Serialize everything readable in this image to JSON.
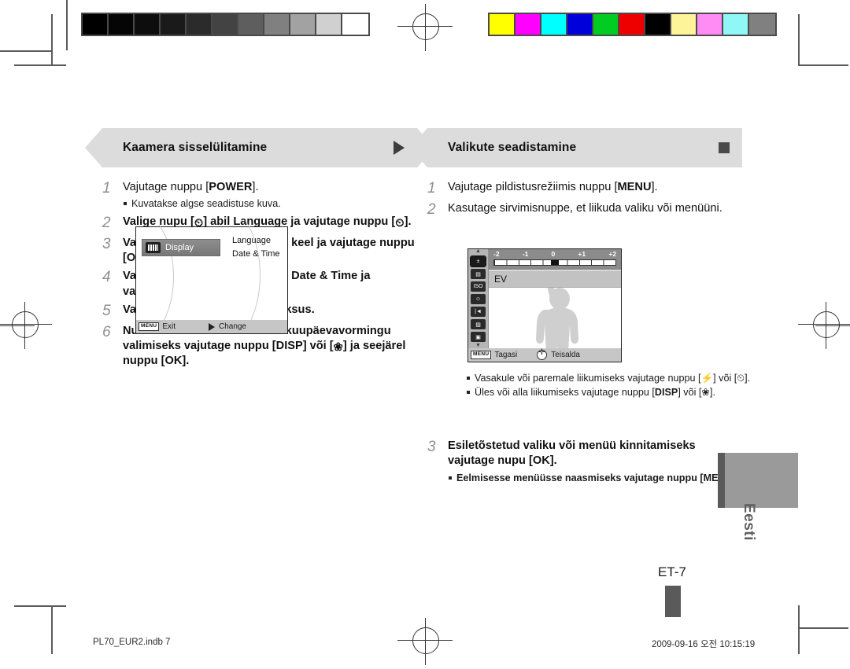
{
  "document": {
    "page_number": "ET-7",
    "language_tab": "Eesti",
    "footer_left": "PL70_EUR2.indb   7",
    "footer_right": "2009-09-16   오전 10:15:19"
  },
  "calibration": {
    "grayscale_label": "grayscale-step-wedge",
    "grayscale_patches": [
      "#000000",
      "#050505",
      "#0d0d0d",
      "#1a1a1a",
      "#2b2b2b",
      "#434343",
      "#5e5e5e",
      "#808080",
      "#a2a2a2",
      "#d0d0d0",
      "#ffffff"
    ],
    "color_label": "color-control-bar",
    "color_patches": [
      "#ffff00",
      "#ff00ff",
      "#00ffff",
      "#0000dd",
      "#00cc22",
      "#ee0000",
      "#000000",
      "#fdf398",
      "#ff8cf5",
      "#90f7f7",
      "#808080"
    ]
  },
  "left_column": {
    "banner": {
      "title": "Kaamera sisselülitamine",
      "marker": "triangle-right"
    },
    "steps": [
      {
        "num": "1",
        "text_html": "Vajutage nuppu [<b>POWER</b>].",
        "bold": false,
        "bullets": [
          "Kuvatakse algse seadistuse kuva."
        ]
      },
      {
        "num": "2",
        "text_html": "Valige nupu [<span class=\"gicon\">&#x23F2;</span>] abil <b>Language</b> ja vajutage nuppu [<span class=\"gicon\">&#x23F2;</span>].",
        "bold": true,
        "bullets": []
      },
      {
        "num": "3",
        "text_html": "Valige nupu [<b>DISP</b>] või [<span class=\"gicon\">&#x2740;</span>] abil keel ja vajutage nuppu [<b>OK</b>].",
        "bold": true,
        "bullets": []
      },
      {
        "num": "4",
        "text_html": "Valige nupu [<b>DISP</b>] või [<span class=\"gicon\">&#x2740;</span>] abil <b>Date &amp; Time</b> ja vajutage nuppu [<span class=\"gicon\">&#x23F2;</span>].",
        "bold": true,
        "bullets": []
      },
      {
        "num": "5",
        "text_html": "Valige nupu [<b>&#x26A1;</b>] või [<span class=\"gicon\">&#x23F2;</span>] abil üksus.",
        "bold": true,
        "bullets": []
      },
      {
        "num": "6",
        "text_html": "Numbri muutmiseks või teise kuupäevavormingu valimiseks vajutage nuppu [<b>DISP</b>] või [<span class=\"gicon\">&#x2740;</span>] ja seejärel nuppu [<b>OK</b>].",
        "bold": true,
        "bullets": []
      }
    ],
    "lcd": {
      "selected_item": "Display",
      "menu_items": [
        "Language",
        "Date & Time"
      ],
      "bottom_menu_chip": "MENU",
      "bottom_left_label": "Exit",
      "bottom_right_label": "Change"
    }
  },
  "right_column": {
    "banner": {
      "title": "Valikute seadistamine",
      "marker": "square"
    },
    "steps": [
      {
        "num": "1",
        "text_html": "Vajutage pildistusrežiimis nuppu [<b>MENU</b>].",
        "bold": false,
        "bullets": []
      },
      {
        "num": "2",
        "text_html": "Kasutage sirvimisnuppe, et liikuda valiku või menüüni.",
        "bold": false,
        "bullets": []
      },
      {
        "num": "3",
        "text_html": "Esiletõstetud valiku või menüü kinnitamiseks vajutage nupu [<b>OK</b>].",
        "bold": true,
        "bullets": [
          "Eelmisesse menüüsse naasmiseks vajutage nuppu [MENU]."
        ]
      }
    ],
    "lcd_bullets": [
      "Vasakule või paremale liikumiseks vajutage nuppu [⚡] või [⏲].",
      "Üles või alla liikumiseks vajutage nuppu [DISP] või [❀]."
    ],
    "lcd": {
      "ev_ticks": [
        "-2",
        "-1",
        "0",
        "+1",
        "+2"
      ],
      "ev_label": "EV",
      "ev_value": "0",
      "sidebar_icons": [
        "ev-icon",
        "resolution-icon",
        "iso-icon",
        "face-detect-off-icon",
        "focus-icon",
        "quality-f-icon",
        "acb-off-icon"
      ],
      "bottom_menu_chip": "MENU",
      "bottom_left_label": "Tagasi",
      "bottom_right_label": "Teisalda"
    }
  }
}
